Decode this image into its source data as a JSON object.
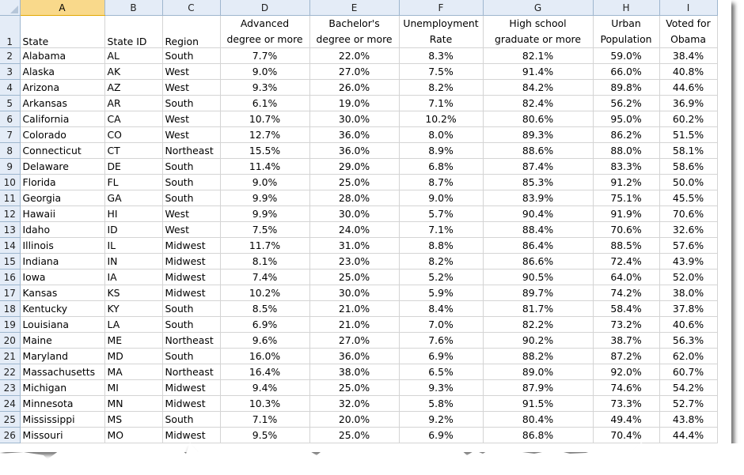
{
  "columns": [
    "A",
    "B",
    "C",
    "D",
    "E",
    "F",
    "G",
    "H",
    "I"
  ],
  "selected_column": "A",
  "headers": {
    "state": "State",
    "state_id": "State ID",
    "region": "Region",
    "advanced": "Advanced degree or more",
    "bachelors": "Bachelor's degree or more",
    "unemployment": "Unemployment Rate",
    "highschool": "High school graduate or more",
    "urban": "Urban Population",
    "obama": "Voted for Obama"
  },
  "rows": [
    {
      "n": "2",
      "state": "Alabama",
      "id": "AL",
      "region": "South",
      "adv": "7.7%",
      "bach": "22.0%",
      "unemp": "8.3%",
      "hs": "82.1%",
      "urban": "59.0%",
      "obama": "38.4%"
    },
    {
      "n": "3",
      "state": "Alaska",
      "id": "AK",
      "region": "West",
      "adv": "9.0%",
      "bach": "27.0%",
      "unemp": "7.5%",
      "hs": "91.4%",
      "urban": "66.0%",
      "obama": "40.8%"
    },
    {
      "n": "4",
      "state": "Arizona",
      "id": "AZ",
      "region": "West",
      "adv": "9.3%",
      "bach": "26.0%",
      "unemp": "8.2%",
      "hs": "84.2%",
      "urban": "89.8%",
      "obama": "44.6%"
    },
    {
      "n": "5",
      "state": "Arkansas",
      "id": "AR",
      "region": "South",
      "adv": "6.1%",
      "bach": "19.0%",
      "unemp": "7.1%",
      "hs": "82.4%",
      "urban": "56.2%",
      "obama": "36.9%"
    },
    {
      "n": "6",
      "state": "California",
      "id": "CA",
      "region": "West",
      "adv": "10.7%",
      "bach": "30.0%",
      "unemp": "10.2%",
      "hs": "80.6%",
      "urban": "95.0%",
      "obama": "60.2%"
    },
    {
      "n": "7",
      "state": "Colorado",
      "id": "CO",
      "region": "West",
      "adv": "12.7%",
      "bach": "36.0%",
      "unemp": "8.0%",
      "hs": "89.3%",
      "urban": "86.2%",
      "obama": "51.5%"
    },
    {
      "n": "8",
      "state": "Connecticut",
      "id": "CT",
      "region": "Northeast",
      "adv": "15.5%",
      "bach": "36.0%",
      "unemp": "8.9%",
      "hs": "88.6%",
      "urban": "88.0%",
      "obama": "58.1%"
    },
    {
      "n": "9",
      "state": "Delaware",
      "id": "DE",
      "region": "South",
      "adv": "11.4%",
      "bach": "29.0%",
      "unemp": "6.8%",
      "hs": "87.4%",
      "urban": "83.3%",
      "obama": "58.6%"
    },
    {
      "n": "10",
      "state": "Florida",
      "id": "FL",
      "region": "South",
      "adv": "9.0%",
      "bach": "25.0%",
      "unemp": "8.7%",
      "hs": "85.3%",
      "urban": "91.2%",
      "obama": "50.0%"
    },
    {
      "n": "11",
      "state": "Georgia",
      "id": "GA",
      "region": "South",
      "adv": "9.9%",
      "bach": "28.0%",
      "unemp": "9.0%",
      "hs": "83.9%",
      "urban": "75.1%",
      "obama": "45.5%"
    },
    {
      "n": "12",
      "state": "Hawaii",
      "id": "HI",
      "region": "West",
      "adv": "9.9%",
      "bach": "30.0%",
      "unemp": "5.7%",
      "hs": "90.4%",
      "urban": "91.9%",
      "obama": "70.6%"
    },
    {
      "n": "13",
      "state": "Idaho",
      "id": "ID",
      "region": "West",
      "adv": "7.5%",
      "bach": "24.0%",
      "unemp": "7.1%",
      "hs": "88.4%",
      "urban": "70.6%",
      "obama": "32.6%"
    },
    {
      "n": "14",
      "state": "Illinois",
      "id": "IL",
      "region": "Midwest",
      "adv": "11.7%",
      "bach": "31.0%",
      "unemp": "8.8%",
      "hs": "86.4%",
      "urban": "88.5%",
      "obama": "57.6%"
    },
    {
      "n": "15",
      "state": "Indiana",
      "id": "IN",
      "region": "Midwest",
      "adv": "8.1%",
      "bach": "23.0%",
      "unemp": "8.2%",
      "hs": "86.6%",
      "urban": "72.4%",
      "obama": "43.9%"
    },
    {
      "n": "16",
      "state": "Iowa",
      "id": "IA",
      "region": "Midwest",
      "adv": "7.4%",
      "bach": "25.0%",
      "unemp": "5.2%",
      "hs": "90.5%",
      "urban": "64.0%",
      "obama": "52.0%"
    },
    {
      "n": "17",
      "state": "Kansas",
      "id": "KS",
      "region": "Midwest",
      "adv": "10.2%",
      "bach": "30.0%",
      "unemp": "5.9%",
      "hs": "89.7%",
      "urban": "74.2%",
      "obama": "38.0%"
    },
    {
      "n": "18",
      "state": "Kentucky",
      "id": "KY",
      "region": "South",
      "adv": "8.5%",
      "bach": "21.0%",
      "unemp": "8.4%",
      "hs": "81.7%",
      "urban": "58.4%",
      "obama": "37.8%"
    },
    {
      "n": "19",
      "state": "Louisiana",
      "id": "LA",
      "region": "South",
      "adv": "6.9%",
      "bach": "21.0%",
      "unemp": "7.0%",
      "hs": "82.2%",
      "urban": "73.2%",
      "obama": "40.6%"
    },
    {
      "n": "20",
      "state": "Maine",
      "id": "ME",
      "region": "Northeast",
      "adv": "9.6%",
      "bach": "27.0%",
      "unemp": "7.6%",
      "hs": "90.2%",
      "urban": "38.7%",
      "obama": "56.3%"
    },
    {
      "n": "21",
      "state": "Maryland",
      "id": "MD",
      "region": "South",
      "adv": "16.0%",
      "bach": "36.0%",
      "unemp": "6.9%",
      "hs": "88.2%",
      "urban": "87.2%",
      "obama": "62.0%"
    },
    {
      "n": "22",
      "state": "Massachusetts",
      "id": "MA",
      "region": "Northeast",
      "adv": "16.4%",
      "bach": "38.0%",
      "unemp": "6.5%",
      "hs": "89.0%",
      "urban": "92.0%",
      "obama": "60.7%"
    },
    {
      "n": "23",
      "state": "Michigan",
      "id": "MI",
      "region": "Midwest",
      "adv": "9.4%",
      "bach": "25.0%",
      "unemp": "9.3%",
      "hs": "87.9%",
      "urban": "74.6%",
      "obama": "54.2%"
    },
    {
      "n": "24",
      "state": "Minnesota",
      "id": "MN",
      "region": "Midwest",
      "adv": "10.3%",
      "bach": "32.0%",
      "unemp": "5.8%",
      "hs": "91.5%",
      "urban": "73.3%",
      "obama": "52.7%"
    },
    {
      "n": "25",
      "state": "Mississippi",
      "id": "MS",
      "region": "South",
      "adv": "7.1%",
      "bach": "20.0%",
      "unemp": "9.2%",
      "hs": "80.4%",
      "urban": "49.4%",
      "obama": "43.8%"
    },
    {
      "n": "26",
      "state": "Missouri",
      "id": "MO",
      "region": "Midwest",
      "adv": "9.5%",
      "bach": "25.0%",
      "unemp": "6.9%",
      "hs": "86.8%",
      "urban": "70.4%",
      "obama": "44.4%"
    }
  ]
}
